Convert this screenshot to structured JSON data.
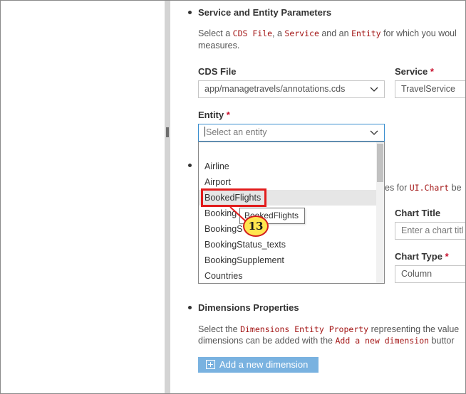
{
  "service_section": {
    "title": "Service and Entity Parameters",
    "desc_prefix": "Select a ",
    "desc_cds": "CDS File",
    "desc_sep1": ", a ",
    "desc_service": "Service",
    "desc_sep2": " and an ",
    "desc_entity": "Entity",
    "desc_suffix": " for which you woul",
    "desc_line2": "measures."
  },
  "cds_file": {
    "label": "CDS File",
    "value": "app/managetravels/annotations.cds"
  },
  "service": {
    "label": "Service",
    "required_mark": "*",
    "value": "TravelService"
  },
  "entity": {
    "label": "Entity",
    "required_mark": "*",
    "placeholder": "Select an entity",
    "options": [
      "Airline",
      "Airport",
      "BookedFlights",
      "Booking",
      "BookingS",
      "BookingStatus_texts",
      "BookingSupplement",
      "Countries"
    ],
    "hovered_option": "BookedFlights"
  },
  "tooltip": {
    "text": "BookedFlights"
  },
  "step_badge": {
    "number": "13"
  },
  "chart_section": {
    "desc_visible_tail": "es for ",
    "desc_code": "UI.Chart",
    "desc_end": " be"
  },
  "chart_title": {
    "label": "Chart Title",
    "placeholder": "Enter a chart titl"
  },
  "chart_type": {
    "label": "Chart Type",
    "required_mark": "*",
    "value": "Column"
  },
  "dimensions_section": {
    "title": "Dimensions Properties",
    "desc_prefix": "Select the ",
    "desc_code1": "Dimensions Entity Property",
    "desc_suffix": " representing the value",
    "desc_line2_prefix": "dimensions can be added with the ",
    "desc_code2": "Add a new dimension",
    "desc_line2_suffix": " buttor"
  },
  "add_dimension_button": {
    "label": "Add a new dimension"
  },
  "colors": {
    "accent_button": "#79b2e0",
    "focus_border": "#3c8fcf",
    "annotation_red": "#e21c1c",
    "badge_yellow": "#ffe54f",
    "code_red": "#a31515"
  }
}
